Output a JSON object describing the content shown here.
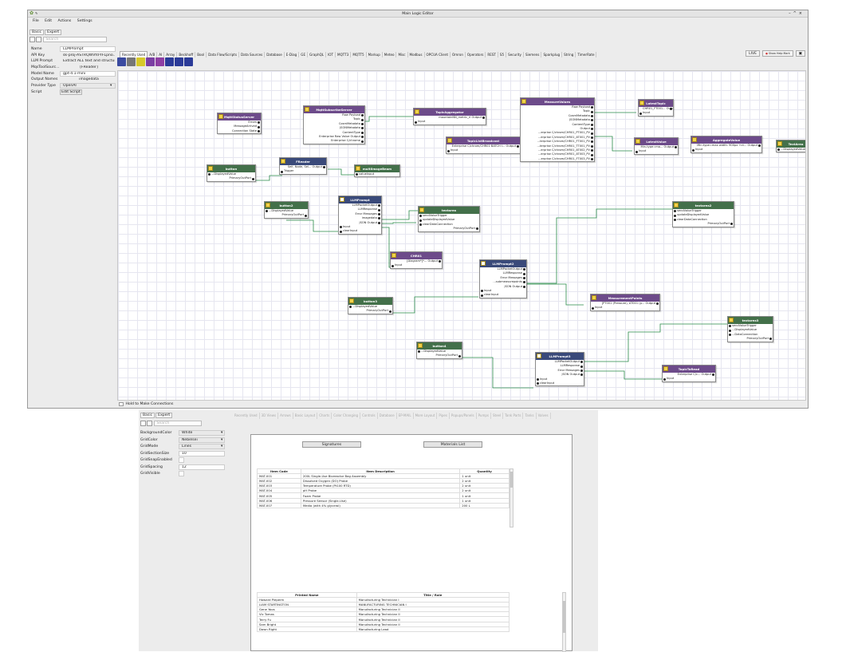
{
  "window": {
    "title": "Main Logic Editor",
    "menu": [
      "File",
      "Edit",
      "Actions",
      "Settings"
    ]
  },
  "left_panel": {
    "tabs": [
      "Basic",
      "Expert"
    ],
    "search_placeholder": "Search",
    "props": [
      {
        "k": "Name",
        "v": "LLMPrompt"
      },
      {
        "k": "API Key",
        "v": "sk-proj-ASTRQWVfd-YFLpno..."
      },
      {
        "k": "LLM Prompt",
        "v": "Extract ALL text and structur..."
      },
      {
        "k": "MqsToolSourc...",
        "v": "[FReader]"
      },
      {
        "k": "Model Name",
        "v": "gpt-4.1-mini"
      },
      {
        "k": "Output Names",
        "v": "imagedata"
      },
      {
        "k": "Provider Type",
        "v": "OpenAI"
      },
      {
        "k": "Script",
        "v": "Edit Script"
      }
    ]
  },
  "palette_tabs": [
    "Recently Used",
    "A/B",
    "AI",
    "Array",
    "Beckhoff",
    "Bool",
    "Data Flow/Scripts",
    "Data Sources",
    "Database",
    "E-Diag",
    "GE",
    "GraphQL",
    "IOT",
    "MQTT3",
    "MQTT5",
    "Markup",
    "Meteo",
    "Misc",
    "Modbus",
    "OPCUA Client",
    "Omron",
    "Operators",
    "REST",
    "S5",
    "Security",
    "Siemens",
    "Sparkplug",
    "String",
    "TimerRate"
  ],
  "right_buttons": {
    "live": "LIVE",
    "help": "Show Help Mark"
  },
  "palette_icons": [
    {
      "name": "wave-icon",
      "color": "#3a4aa0"
    },
    {
      "name": "gear-icon",
      "color": "#777"
    },
    {
      "name": "aruco-icon",
      "color": "#d7c92a"
    },
    {
      "name": "trigger-icon",
      "color": "#7b3fa3"
    },
    {
      "name": "list-icon",
      "color": "#8e3fa3"
    },
    {
      "name": "bar-chart-icon",
      "color": "#2b3b98"
    },
    {
      "name": "line-chart-icon",
      "color": "#2b3b98"
    },
    {
      "name": "arrow-icon",
      "color": "#2b3b98"
    }
  ],
  "nodes": [
    {
      "title": "MqttStatusServer",
      "color": "p",
      "lines": [
        [
          "Errors",
          "r"
        ],
        [
          "MessageArrived",
          "r"
        ],
        [
          "Connection State",
          "r"
        ]
      ]
    },
    {
      "title": "MqttSubscribeServer",
      "color": "p",
      "lines": [
        [
          "Raw Payload",
          "r"
        ],
        [
          "Topic",
          "r"
        ],
        [
          "CosmMetadata",
          "r"
        ],
        [
          "JSONMetadata",
          "r"
        ],
        [
          "ContentType",
          "r"
        ],
        [
          "Enterprise Raw Value Output",
          "r"
        ],
        [
          "Enterprise C/chrome",
          "r"
        ]
      ]
    },
    {
      "title": "TopicAggregator",
      "color": "y",
      "lines": [
        [
          "mountainNN_metric_rl Output",
          "r"
        ],
        [
          "Input",
          "l"
        ]
      ]
    },
    {
      "title": "TopicListBroadcast",
      "color": "y",
      "lines": [
        [
          "Enterprise C/chrom/CHR01 BATCH I... Output",
          "r"
        ],
        [
          "Input",
          "l"
        ]
      ]
    },
    {
      "title": "MeasureValues",
      "color": "y",
      "lines": [
        [
          "Raw Payload",
          "r"
        ],
        [
          "Topic",
          "r"
        ],
        [
          "CosmMetadata",
          "r"
        ],
        [
          "JSONMetadata",
          "r"
        ],
        [
          "ContentType",
          "r"
        ],
        [
          "Output",
          "r"
        ],
        [
          "...erprise C/chrom/CHR01_PT001_PV",
          "r"
        ],
        [
          "...erprise C/chrom/CHR01_AT001_PV",
          "r"
        ],
        [
          "...terprise C/chrom/CHR01_FT001_PV",
          "r"
        ],
        [
          "...terprise C/chrom/CHR01_TT001_PV",
          "r"
        ],
        [
          "...erprise C/chrom/CHR01_AT002_PV",
          "r"
        ],
        [
          "...erprise C/chrom/CHR01_AT003_PV",
          "r"
        ],
        [
          "...erprise C/chrom/CHR01_FT003_PV",
          "r"
        ]
      ]
    },
    {
      "title": "LatestTopic",
      "color": "y",
      "lines": [
        [
          "CHR01_FT001... Output",
          "r"
        ],
        [
          "Input",
          "l"
        ]
      ]
    },
    {
      "title": "LatestValue",
      "color": "y",
      "lines": [
        [
          "Min-type=ma... Output",
          "r"
        ],
        [
          "Input",
          "l"
        ]
      ]
    },
    {
      "title": "AggregateValue",
      "color": "y",
      "lines": [
        [
          "Min-type=max width: 900px +ct... Output",
          "r"
        ],
        [
          "Input",
          "l"
        ]
      ]
    },
    {
      "title": "TextArea",
      "color": "g",
      "lines": [
        [
          "...DisplayedValue",
          "l"
        ]
      ]
    },
    {
      "title": "button",
      "color": "g",
      "lines": [
        [
          "...DisplayedValue",
          "l"
        ],
        [
          "PrimaryOutPort",
          "r"
        ]
      ]
    },
    {
      "title": "FReader",
      "color": "b",
      "lines": [
        [
          "Self, Node, Sel... Output",
          "r"
        ],
        [
          "Trigger",
          "l"
        ]
      ]
    },
    {
      "title": "multiImageBeam",
      "color": "g",
      "lines": [
        [
          "valueInput",
          "l"
        ]
      ]
    },
    {
      "title": "button2",
      "color": "g",
      "lines": [
        [
          "...DisplayedValue",
          "l"
        ],
        [
          "PrimaryOutPort",
          "r"
        ]
      ]
    },
    {
      "title": "LLMPrompt",
      "color": "w",
      "lines": [
        [
          "LLMPacketOutput",
          "r"
        ],
        [
          "LLMResponse",
          "r"
        ],
        [
          "Error Messages",
          "r"
        ],
        [
          "imagedata",
          "r"
        ],
        [
          "JSON Output",
          "r"
        ],
        [
          "Input",
          "l"
        ],
        [
          "clearInput",
          "l"
        ]
      ]
    },
    {
      "title": "textarea",
      "color": "g",
      "lines": [
        [
          "sendValueTrigger",
          "l"
        ],
        [
          "updateDisplayedValue",
          "l"
        ],
        [
          "clearDataConnection",
          "l"
        ],
        [
          "PrimaryOutPort",
          "r"
        ]
      ]
    },
    {
      "title": "CHR01",
      "color": "y",
      "lines": [
        [
          "[Diagram*]*... Output",
          "r"
        ],
        [
          "Input",
          "l"
        ]
      ]
    },
    {
      "title": "LLMPrompt2",
      "color": "w",
      "lines": [
        [
          "LLMPacketOutput",
          "r"
        ],
        [
          "LLMResponse",
          "r"
        ],
        [
          "Error Messages",
          "r"
        ],
        [
          "...submeasurepoints",
          "r"
        ],
        [
          "JSON Output",
          "r"
        ],
        [
          "Input",
          "l"
        ],
        [
          "clearInput",
          "l"
        ]
      ]
    },
    {
      "title": "textarea2",
      "color": "g",
      "lines": [
        [
          "sendValueTrigger",
          "l"
        ],
        [
          "updateDisplayedValue",
          "l"
        ],
        [
          "clearDataConnection",
          "l"
        ],
        [
          "PrimaryOutPort",
          "r"
        ]
      ]
    },
    {
      "title": "button3",
      "color": "g",
      "lines": [
        [
          "...DisplayedValue",
          "l"
        ],
        [
          "PrimaryOutPort",
          "r"
        ]
      ]
    },
    {
      "title": "MeasurementPoints",
      "color": "y",
      "lines": [
        [
          "[PT001 (Pressure), AT001 (p... Output",
          "r"
        ],
        [
          "Input",
          "l"
        ]
      ]
    },
    {
      "title": "button4",
      "color": "g",
      "lines": [
        [
          "...DisplayedValue",
          "l"
        ],
        [
          "PrimaryOutPort",
          "r"
        ]
      ]
    },
    {
      "title": "LLMPrompt3",
      "color": "w",
      "lines": [
        [
          "LLMPacketOutput",
          "r"
        ],
        [
          "LLMResponse",
          "r"
        ],
        [
          "Error Messages",
          "r"
        ],
        [
          "JSON Output",
          "r"
        ],
        [
          "Input",
          "l"
        ],
        [
          "clearInput",
          "l"
        ]
      ]
    },
    {
      "title": "textarea3",
      "color": "g",
      "lines": [
        [
          "sendValueTrigger",
          "l"
        ],
        [
          "...DisplayedValue",
          "l"
        ],
        [
          "...DataConnection",
          "l"
        ],
        [
          "PrimaryOutPort",
          "r"
        ]
      ]
    },
    {
      "title": "TopicToRead",
      "color": "y",
      "lines": [
        [
          "Enterprise C/c... Output",
          "r"
        ],
        [
          "Input",
          "l"
        ]
      ]
    }
  ],
  "status": {
    "text": "Hold to Make Connections"
  },
  "second": {
    "tabs": [
      "Basic",
      "Expert"
    ],
    "search_placeholder": "Search",
    "props": [
      {
        "k": "BackgroundColor",
        "v": "White"
      },
      {
        "k": "GridColor",
        "v": "Nebelsei"
      },
      {
        "k": "GridMode",
        "v": "Lines"
      },
      {
        "k": "GridSectionSize",
        "v": "10"
      },
      {
        "k": "GridSnapEnabled",
        "v": ""
      },
      {
        "k": "GridSpacing",
        "v": "12"
      },
      {
        "k": "GridVisible",
        "v": ""
      }
    ],
    "tabs2": [
      "Recently Used",
      "3D Views",
      "Arrows",
      "Basic Layout",
      "Charts",
      "Color Changing",
      "Controls",
      "Database",
      "EP-MAIL",
      "More Layout",
      "Pipes",
      "Popups/Panels",
      "Pumps",
      "Steel",
      "Tank Parts",
      "Tanks",
      "Valves"
    ],
    "buttons": {
      "signatures": "Signatures",
      "materials": "Materials List"
    },
    "materials": {
      "headers": [
        "Item Code",
        "Item Description",
        "Quantity"
      ],
      "rows": [
        [
          "MAT-001",
          "200L Single-Use Bioreactor Bag Assembly",
          "1 unit"
        ],
        [
          "MAT-002",
          "Dissolved Oxygen (DO) Probe",
          "2 unit"
        ],
        [
          "MAT-003",
          "Temperature Probe (Pt100 RTD)",
          "2 unit"
        ],
        [
          "MAT-004",
          "pH Probe",
          "2 unit"
        ],
        [
          "MAT-005",
          "Foam Probe",
          "1 unit"
        ],
        [
          "MAT-006",
          "Pressure Sensor (Single-Use)",
          "1 unit"
        ],
        [
          "MAT-007",
          "Media (with 4% glycerol)",
          "200 L"
        ]
      ]
    },
    "signatures": {
      "headers": [
        "Printed Name",
        "Title / Role"
      ],
      "rows": [
        [
          "Howard Pieperm",
          "Manufacturing Technician I"
        ],
        [
          "LIAM STARTINGTON",
          "MANUFACTURING TECHNICIAN I"
        ],
        [
          "Gene Yoos",
          "Manufacturing Technician II"
        ],
        [
          "Vic Tomas",
          "Manufacturing Technician II"
        ],
        [
          "Terry Fu",
          "Manufacturing Technician II"
        ],
        [
          "Sam Bright",
          "Manufacturing Technician II"
        ],
        [
          "Dawn Right",
          "Manufacturing Lead"
        ]
      ]
    }
  }
}
